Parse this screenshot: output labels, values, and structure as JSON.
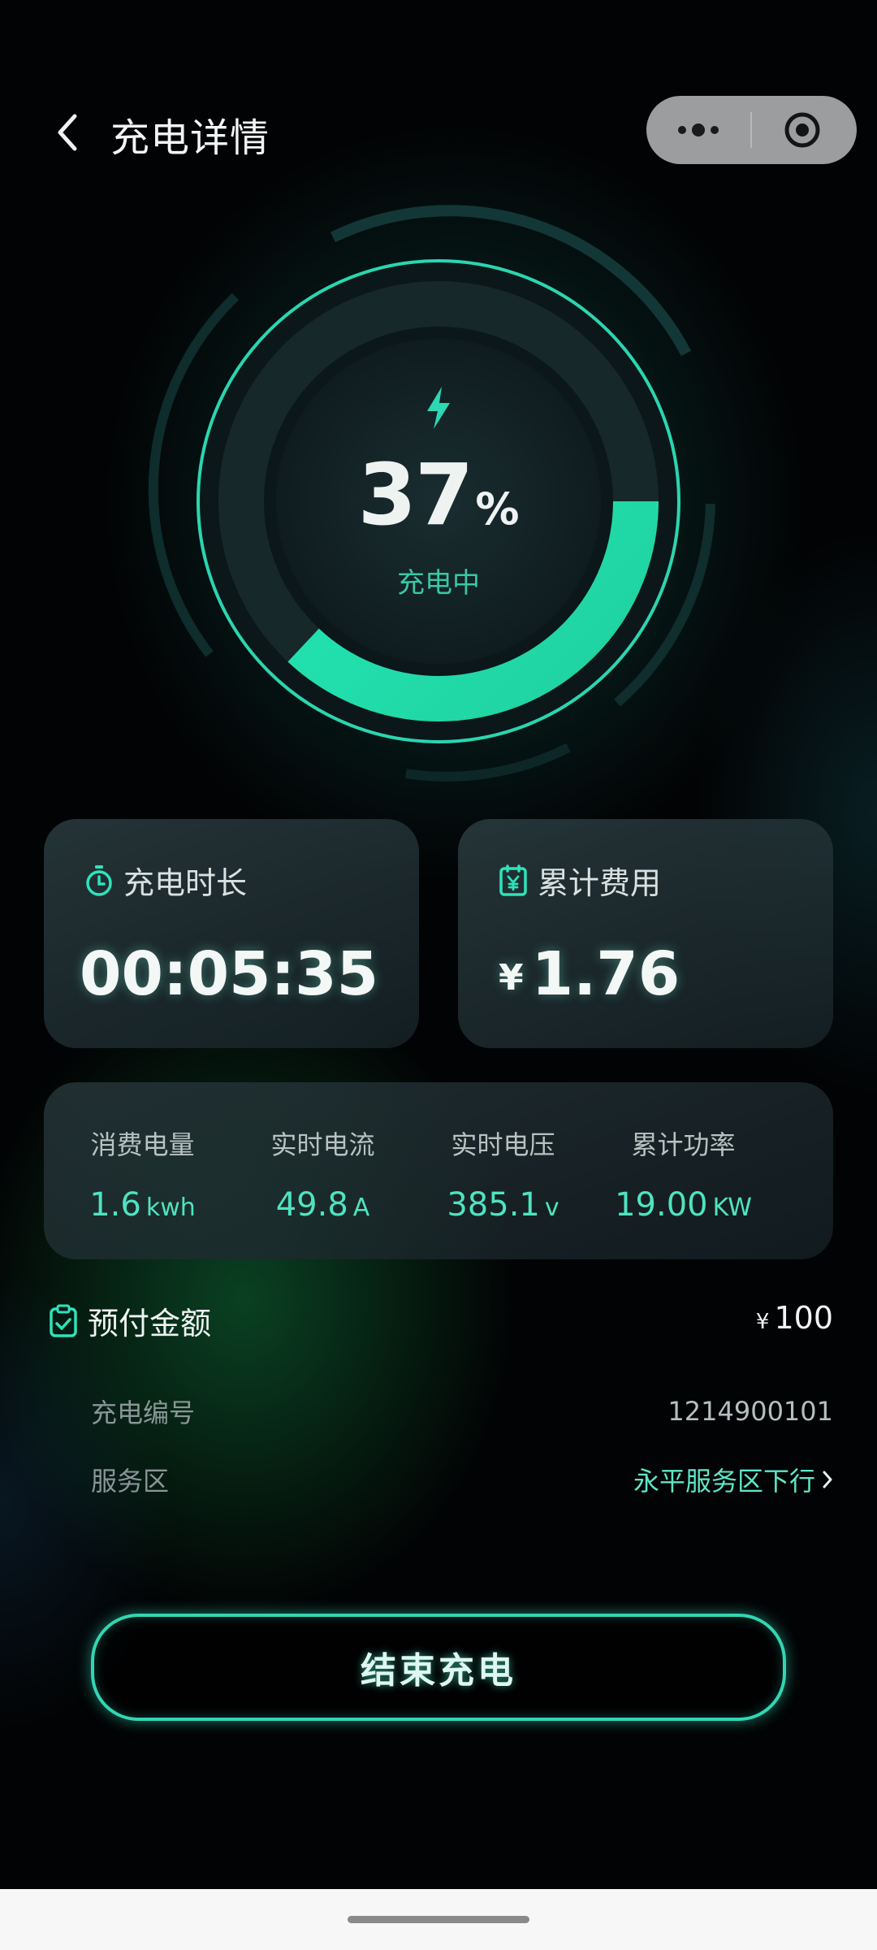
{
  "header": {
    "title": "充电详情",
    "back_icon": "chevron-left-icon",
    "more_icon": "more-dots-icon",
    "close_icon": "target-circle-icon"
  },
  "gauge": {
    "percent": "37",
    "percent_sign": "%",
    "progress_fraction": 0.37,
    "status": "充电中",
    "icon": "lightning-icon",
    "accent_color": "#1de0b0"
  },
  "cards": {
    "duration": {
      "label": "充电时长",
      "value": "00:05:35",
      "icon": "stopwatch-icon"
    },
    "cost": {
      "label": "累计费用",
      "currency": "¥",
      "value": "1.76",
      "icon": "yen-receipt-icon"
    }
  },
  "stats": [
    {
      "label": "消费电量",
      "value": "1.6",
      "unit": "kwh"
    },
    {
      "label": "实时电流",
      "value": "49.8",
      "unit": "A"
    },
    {
      "label": "实时电压",
      "value": "385.1",
      "unit": "v"
    },
    {
      "label": "累计功率",
      "value": "19.00",
      "unit": "KW"
    }
  ],
  "prepaid": {
    "label": "预付金额",
    "currency": "¥",
    "value": "100",
    "icon": "clipboard-check-icon"
  },
  "details": {
    "charge_no_label": "充电编号",
    "charge_no_value": "1214900101",
    "service_label": "服务区",
    "service_value": "永平服务区下行"
  },
  "end_button": {
    "label": "结束充电"
  }
}
